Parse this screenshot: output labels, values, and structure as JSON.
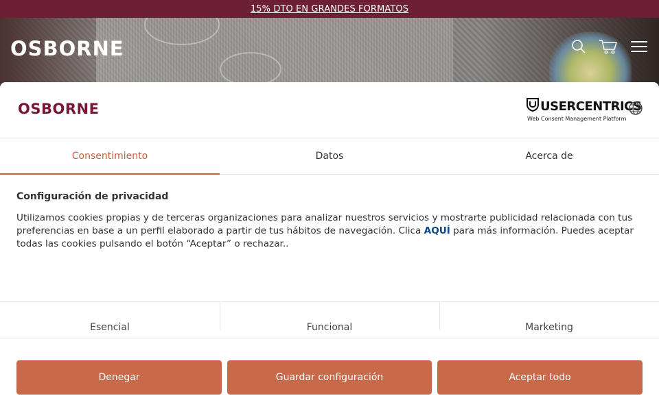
{
  "promo": {
    "text": "15% DTO EN GRANDES FORMATOS"
  },
  "header": {
    "logo_text": "OSBORNE",
    "icons": [
      "search-icon",
      "cart-icon",
      "menu-icon"
    ]
  },
  "consent": {
    "brand_logo_text": "OSBORNE",
    "provider": {
      "name": "USERCENTRICS",
      "subtitle": "Web Consent Management Platform"
    },
    "language_icon": "globe-icon",
    "tabs": [
      {
        "label": "Consentimiento",
        "active": true
      },
      {
        "label": "Datos",
        "active": false
      },
      {
        "label": "Acerca de",
        "active": false
      }
    ],
    "body": {
      "heading": "Configuración de privacidad",
      "text_before_link": "Utilizamos cookies propias y de terceras organizaciones para analizar nuestros servicios y mostrarte publicidad relacionada con tus preferencias en base a un perfil elaborado a partir de tus hábitos de navegación. Clica ",
      "link_text": "AQUÍ",
      "text_after_link": " para más información. Puedes aceptar todas las cookies pulsando el botón “Aceptar” o rechazar.."
    },
    "categories": [
      "Esencial",
      "Funcional",
      "Marketing"
    ],
    "buttons": {
      "deny": "Denegar",
      "save": "Guardar configuración",
      "accept": "Aceptar todo"
    },
    "colors": {
      "accent": "#c1603c",
      "button": "#c86a4a",
      "brand": "#7a1533",
      "promo_bar": "#6d1f36",
      "link": "#0a4a8a"
    }
  }
}
